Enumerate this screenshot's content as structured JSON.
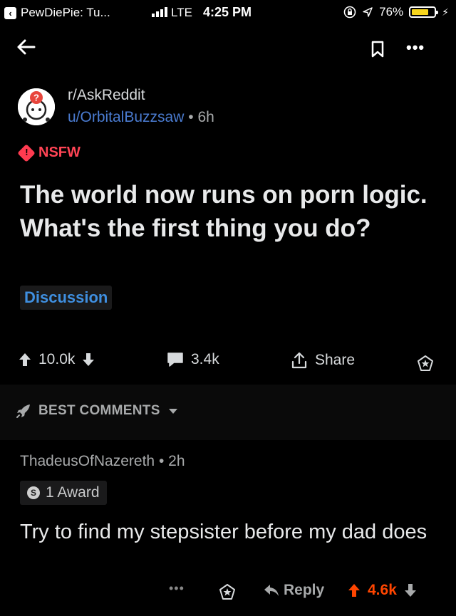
{
  "status_bar": {
    "back_app": "PewDiePie: Tu...",
    "network": "LTE",
    "time": "4:25 PM",
    "battery": "76%",
    "battery_level": 0.76,
    "battery_color": "#f7d51d"
  },
  "post": {
    "subreddit": "r/AskReddit",
    "author": "u/OrbitalBuzzsaw",
    "separator": "•",
    "age": "6h",
    "nsfw_label": "NSFW",
    "title": "The world now runs on porn logic. What's the first thing you do?",
    "flair": "Discussion",
    "upvotes": "10.0k",
    "comments": "3.4k",
    "share_label": "Share"
  },
  "comments_header": {
    "sort_label": "BEST COMMENTS"
  },
  "comment": {
    "author": "ThadeusOfNazereth",
    "separator": "•",
    "age": "2h",
    "award": "1 Award",
    "body": "Try to find my stepsister before my dad does",
    "more": "•••",
    "reply_label": "Reply",
    "score": "4.6k"
  },
  "colors": {
    "upvote_active": "#ff4500",
    "nsfw": "#ff3b50",
    "username": "#4a7bd0",
    "flair": "#3f8fe0"
  }
}
